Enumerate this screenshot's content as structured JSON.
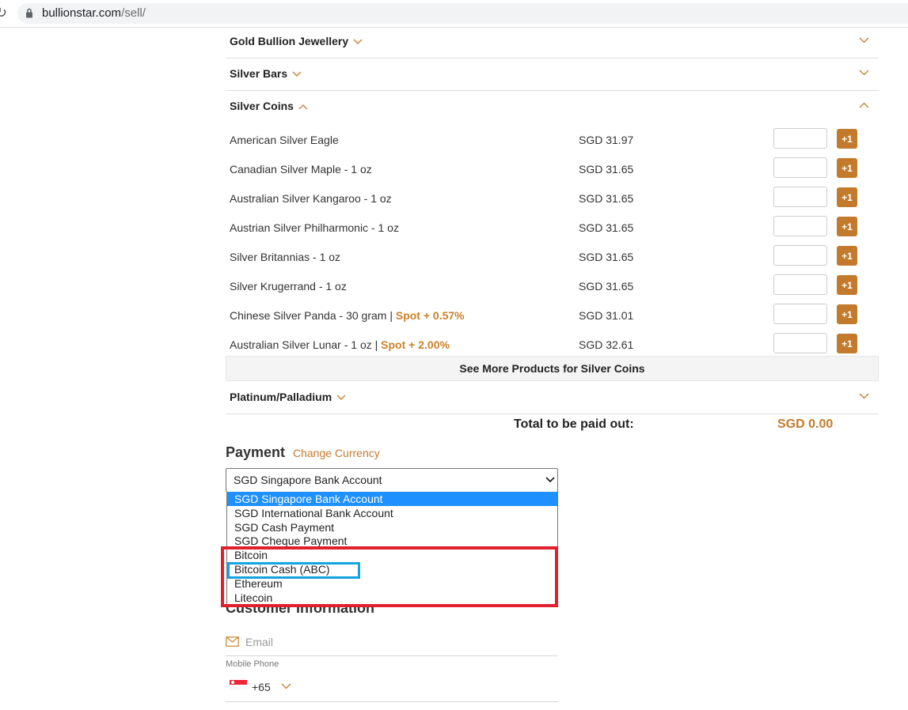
{
  "browser": {
    "url_domain": "bullionstar.com",
    "url_path": "/sell/"
  },
  "sections": {
    "gold_jewellery": "Gold Bullion Jewellery",
    "silver_bars": "Silver Bars",
    "silver_coins": "Silver Coins",
    "platinum": "Platinum/Palladium"
  },
  "silver_coins": {
    "products": [
      {
        "name": "American Silver Eagle",
        "spot": "",
        "price": "SGD 31.97",
        "button": "+1"
      },
      {
        "name": "Canadian Silver Maple - 1 oz",
        "spot": "",
        "price": "SGD 31.65",
        "button": "+1"
      },
      {
        "name": "Australian Silver Kangaroo - 1 oz",
        "spot": "",
        "price": "SGD 31.65",
        "button": "+1"
      },
      {
        "name": "Austrian Silver Philharmonic - 1 oz",
        "spot": "",
        "price": "SGD 31.65",
        "button": "+1"
      },
      {
        "name": "Silver Britannias - 1 oz",
        "spot": "",
        "price": "SGD 31.65",
        "button": "+1"
      },
      {
        "name": "Silver Krugerrand - 1 oz",
        "spot": "",
        "price": "SGD 31.65",
        "button": "+1"
      },
      {
        "name": "Chinese Silver Panda - 30 gram | ",
        "spot": "Spot + 0.57%",
        "price": "SGD 31.01",
        "button": "+1"
      },
      {
        "name": "Australian Silver Lunar - 1 oz | ",
        "spot": "Spot + 2.00%",
        "price": "SGD 32.61",
        "button": "+1"
      }
    ],
    "see_more": "See More Products for Silver Coins"
  },
  "total": {
    "label": "Total to be paid out:",
    "value": "SGD 0.00"
  },
  "payment": {
    "heading": "Payment",
    "change_currency": "Change Currency",
    "selected": "SGD Singapore Bank Account",
    "options": [
      "SGD Singapore Bank Account",
      "SGD International Bank Account",
      "SGD Cash Payment",
      "SGD Cheque Payment",
      "Bitcoin",
      "Bitcoin Cash (ABC)",
      "Ethereum",
      "Litecoin"
    ]
  },
  "customer": {
    "heading": "Customer Information",
    "email_placeholder": "Email",
    "phone_label": "Mobile Phone",
    "dial_code": "+65"
  },
  "colors": {
    "accent": "#c47a2c",
    "highlight_red": "#e0202c",
    "highlight_blue": "#12a3e0",
    "selected_option": "#1e90ff"
  }
}
